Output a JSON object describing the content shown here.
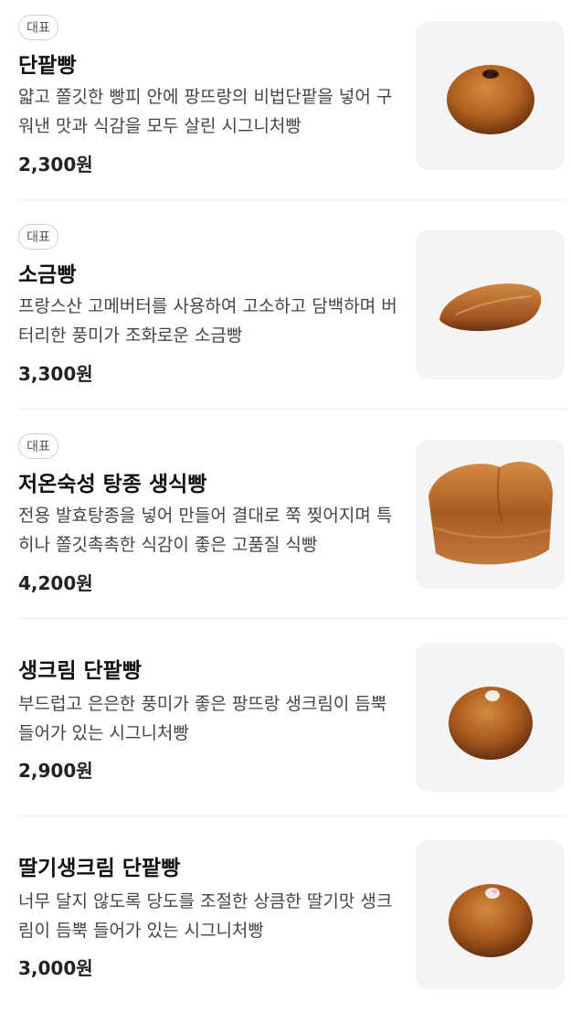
{
  "menu": {
    "items": [
      {
        "badge": "대표",
        "name": "단팥빵",
        "description": "얇고 쫄깃한 빵피 안에 팡뜨랑의 비법단팥을 넣어 구워낸 맛과 식감을 모두 살린 시그니처빵",
        "price": "2,300원",
        "image": "round-bun-with-sesame"
      },
      {
        "badge": "대표",
        "name": "소금빵",
        "description": "프랑스산 고메버터를 사용하여 고소하고 담백하며 버터리한 풍미가 조화로운 소금빵",
        "price": "3,300원",
        "image": "salt-bread-roll"
      },
      {
        "badge": "대표",
        "name": "저온숙성 탕종 생식빵",
        "description": "전용 발효탕종을 넣어 만들어 결대로 쭉 찢어지며 특히나 쫄깃촉촉한 식감이 좋은 고품질 식빵",
        "price": "4,200원",
        "image": "milk-bread-loaf"
      },
      {
        "badge": "",
        "name": "생크림 단팥빵",
        "description": "부드럽고 은은한 풍미가 좋은 팡뜨랑 생크림이 듬뿍 들어가 있는 시그니처빵",
        "price": "2,900원",
        "image": "cream-bun"
      },
      {
        "badge": "",
        "name": "딸기생크림 단팥빵",
        "description": "너무 달지 않도록 당도를 조절한 상큼한 딸기맛 생크림이 듬뿍 들어가 있는 시그니처빵",
        "price": "3,000원",
        "image": "strawberry-cream-bun"
      }
    ]
  },
  "colors": {
    "background": "#ffffff",
    "thumb_background": "#f4f4f4",
    "bread_crust": "#a85a1e",
    "divider": "#ececec"
  }
}
